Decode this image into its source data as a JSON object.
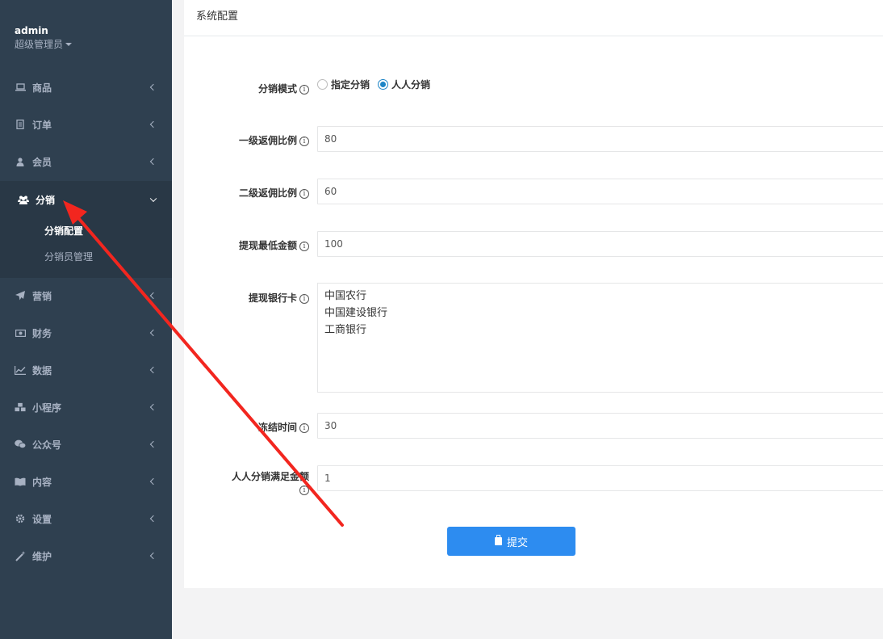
{
  "sidebar": {
    "profile": {
      "name": "admin",
      "role": "超级管理员"
    },
    "items": [
      {
        "label": "商品",
        "icon": "laptop-icon"
      },
      {
        "label": "订单",
        "icon": "file-icon"
      },
      {
        "label": "会员",
        "icon": "user-icon"
      },
      {
        "label": "分销",
        "icon": "users-icon",
        "active": true
      },
      {
        "label": "营销",
        "icon": "paper-plane-icon"
      },
      {
        "label": "财务",
        "icon": "money-icon"
      },
      {
        "label": "数据",
        "icon": "line-chart-icon"
      },
      {
        "label": "小程序",
        "icon": "cubes-icon"
      },
      {
        "label": "公众号",
        "icon": "wechat-icon"
      },
      {
        "label": "内容",
        "icon": "book-icon"
      },
      {
        "label": "设置",
        "icon": "gear-icon"
      },
      {
        "label": "维护",
        "icon": "magic-icon"
      }
    ],
    "subitems": [
      {
        "label": "分销配置",
        "current": true
      },
      {
        "label": "分销员管理"
      }
    ]
  },
  "main": {
    "title": "系统配置",
    "form": {
      "mode": {
        "label": "分销模式",
        "options": [
          "指定分销",
          "人人分销"
        ],
        "selected": "人人分销"
      },
      "level1": {
        "label": "一级返佣比例",
        "value": "80"
      },
      "level2": {
        "label": "二级返佣比例",
        "value": "60"
      },
      "min_withdraw": {
        "label": "提现最低金额",
        "value": "100"
      },
      "banks": {
        "label": "提现银行卡",
        "lines": [
          "中国农行",
          "中国建设银行",
          "工商银行"
        ]
      },
      "freeze": {
        "label": "冻结时间",
        "value": "30"
      },
      "threshold": {
        "label": "人人分销满足金额",
        "value": "1"
      },
      "submit_label": "提交"
    }
  },
  "colors": {
    "sidebar_bg": "#2f4050",
    "primary": "#2d8cf0",
    "annotation_arrow": "#f2261f"
  }
}
